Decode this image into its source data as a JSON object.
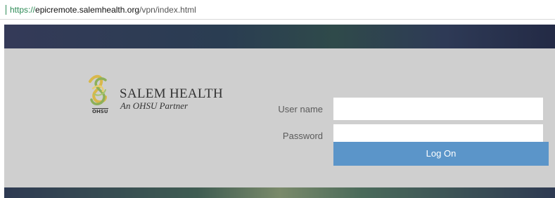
{
  "browser": {
    "url_scheme": "https://",
    "url_host": "epicremote.salemhealth.org",
    "url_path": "/vpn/index.html"
  },
  "branding": {
    "name": "SALEM HEALTH",
    "tagline": "An OHSU Partner",
    "badge": "OHSU",
    "logo_icon": "salem-health-ribbon-icon"
  },
  "login": {
    "username_label": "User name",
    "username_value": "",
    "password_label": "Password",
    "password_value": "",
    "submit_label": "Log On"
  },
  "colors": {
    "button": "#5b95c9",
    "panel": "#cfcfcf",
    "header": "#2a3d52"
  }
}
